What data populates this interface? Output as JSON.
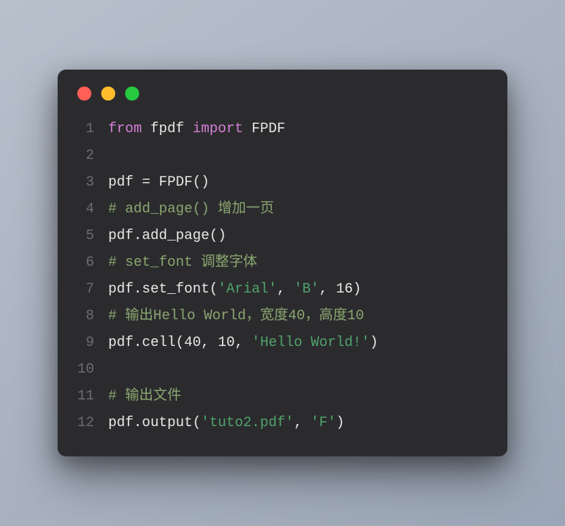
{
  "window": {
    "buttons": {
      "close": "close",
      "minimize": "minimize",
      "zoom": "zoom"
    }
  },
  "code": {
    "lines": [
      {
        "n": "1",
        "tokens": [
          {
            "t": "from",
            "c": "kw"
          },
          {
            "t": " fpdf ",
            "c": ""
          },
          {
            "t": "import",
            "c": "kw"
          },
          {
            "t": " FPDF",
            "c": ""
          }
        ]
      },
      {
        "n": "2",
        "tokens": []
      },
      {
        "n": "3",
        "tokens": [
          {
            "t": "pdf = FPDF()",
            "c": ""
          }
        ]
      },
      {
        "n": "4",
        "tokens": [
          {
            "t": "# add_page() 增加一页",
            "c": "comment"
          }
        ]
      },
      {
        "n": "5",
        "tokens": [
          {
            "t": "pdf.add_page()",
            "c": ""
          }
        ]
      },
      {
        "n": "6",
        "tokens": [
          {
            "t": "# set_font 调整字体",
            "c": "comment"
          }
        ]
      },
      {
        "n": "7",
        "tokens": [
          {
            "t": "pdf.set_font(",
            "c": ""
          },
          {
            "t": "'Arial'",
            "c": "str"
          },
          {
            "t": ", ",
            "c": ""
          },
          {
            "t": "'B'",
            "c": "str"
          },
          {
            "t": ", ",
            "c": ""
          },
          {
            "t": "16",
            "c": "num"
          },
          {
            "t": ")",
            "c": ""
          }
        ]
      },
      {
        "n": "8",
        "tokens": [
          {
            "t": "# 输出Hello World，宽度40，高度10",
            "c": "comment"
          }
        ]
      },
      {
        "n": "9",
        "tokens": [
          {
            "t": "pdf.cell(",
            "c": ""
          },
          {
            "t": "40",
            "c": "num"
          },
          {
            "t": ", ",
            "c": ""
          },
          {
            "t": "10",
            "c": "num"
          },
          {
            "t": ", ",
            "c": ""
          },
          {
            "t": "'Hello World!'",
            "c": "str"
          },
          {
            "t": ")",
            "c": ""
          }
        ]
      },
      {
        "n": "10",
        "tokens": []
      },
      {
        "n": "11",
        "tokens": [
          {
            "t": "# 输出文件",
            "c": "comment"
          }
        ]
      },
      {
        "n": "12",
        "tokens": [
          {
            "t": "pdf.output(",
            "c": ""
          },
          {
            "t": "'tuto2.pdf'",
            "c": "str"
          },
          {
            "t": ", ",
            "c": ""
          },
          {
            "t": "'F'",
            "c": "str"
          },
          {
            "t": ")",
            "c": ""
          }
        ]
      }
    ]
  }
}
